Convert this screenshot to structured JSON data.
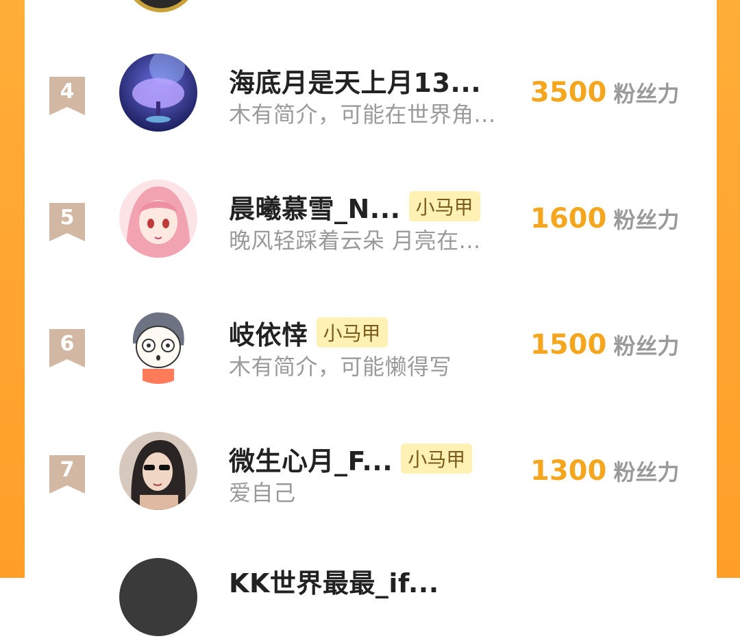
{
  "rows": [
    {
      "rank": "4",
      "name": "海底月是天上月13...",
      "tag": "",
      "bio": "木有简介，可能在世界角...",
      "fans": "3500",
      "unit": "粉丝力",
      "avatar": "galaxy-tree-avatar"
    },
    {
      "rank": "5",
      "name": "晨曦慕雪_N...",
      "tag": "小马甲",
      "bio": "晚风轻踩着云朵 月亮在...",
      "fans": "1600",
      "unit": "粉丝力",
      "avatar": "pink-hair-girl-avatar"
    },
    {
      "rank": "6",
      "name": "岐依悻",
      "tag": "小马甲",
      "bio": "木有简介，可能懒得写",
      "fans": "1500",
      "unit": "粉丝力",
      "avatar": "cartoon-boy-avatar"
    },
    {
      "rank": "7",
      "name": "微生心月_F...",
      "tag": "小马甲",
      "bio": "爱自己",
      "fans": "1300",
      "unit": "粉丝力",
      "avatar": "sunglasses-woman-avatar"
    },
    {
      "rank": "",
      "name": "KK世界最最_if...",
      "tag": "",
      "bio": "",
      "fans": "",
      "unit": "",
      "avatar": "dark-avatar"
    }
  ],
  "colors": {
    "accent": "#f4a71e",
    "side": "#ffa52f",
    "badge": "#d2b8a3",
    "tag_bg": "#fff0b3"
  }
}
